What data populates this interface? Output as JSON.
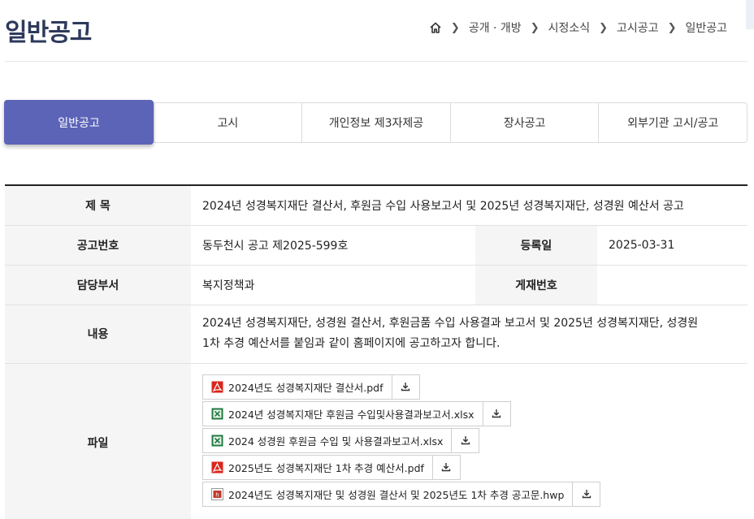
{
  "page": {
    "title": "일반공고"
  },
  "breadcrumb": {
    "items": [
      "공개 · 개방",
      "시정소식",
      "고시공고",
      "일반공고"
    ]
  },
  "tabs": [
    "일반공고",
    "고시",
    "개인정보 제3자제공",
    "장사공고",
    "외부기관 고시/공고"
  ],
  "active_tab": "일반공고",
  "detail": {
    "subject_label": "제 목",
    "subject": "2024년 성경복지재단 결산서, 후원금 수입 사용보고서 및 2025년 성경복지재단, 성경원 예산서 공고",
    "notice_no_label": "공고번호",
    "notice_no": "동두천시 공고 제2025-599호",
    "reg_date_label": "등록일",
    "reg_date": "2025-03-31",
    "dept_label": "담당부서",
    "dept": "복지정책과",
    "post_no_label": "게재번호",
    "post_no": "",
    "content_label": "내용",
    "content_line1": "2024년 성경복지재단, 성경원 결산서, 후원금품  수입 사용결과 보고서 및 2025년  성경복지재단, 성경원",
    "content_line2": "1차 추경 예산서를 붙임과 같이 홈페이지에 공고하고자 합니다.",
    "files_label": "파일",
    "files": [
      {
        "name": "2024년도 성경복지재단 결산서.pdf",
        "type": "pdf"
      },
      {
        "name": "2024년 성경복지재단 후원금 수입및사용결과보고서.xlsx",
        "type": "xlsx"
      },
      {
        "name": "2024 성경원 후원금 수입 및 사용결과보고서.xlsx",
        "type": "xlsx"
      },
      {
        "name": "2025년도 성경복지재단 1차 추경 예산서.pdf",
        "type": "pdf"
      },
      {
        "name": "2024년도 성경복지재단 및 성경원 결산서 및 2025년도 1차 추경 공고문.hwp",
        "type": "hwp"
      }
    ]
  },
  "colors": {
    "accent": "#5c64b8",
    "title": "#2e3a5c",
    "pdf": "#d9261c",
    "xlsx": "#1f7a3f",
    "hwp": "#c0392b"
  }
}
